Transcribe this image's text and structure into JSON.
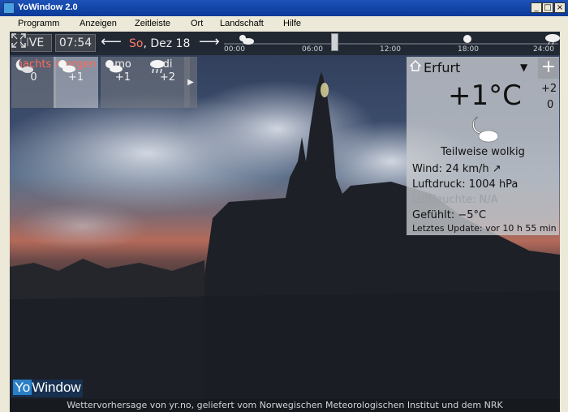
{
  "window": {
    "title": "YoWindow 2.0",
    "min_label": "_",
    "max_label": "□",
    "close_label": "×"
  },
  "menu": [
    "Programm",
    "Anzeigen",
    "Zeitleiste",
    "Ort",
    "Landschaft",
    "Hilfe"
  ],
  "topbar": {
    "live": "LIVE",
    "time": "07:54",
    "back_arrow": "⟵",
    "fwd_arrow": "⟶",
    "date_dow": "So",
    "date_rest": ", Dez 18",
    "ticks": [
      "00:00",
      "06:00",
      "12:00",
      "18:00",
      "24:00"
    ]
  },
  "forecast": [
    {
      "name": "nachts",
      "temp": "0",
      "icon": "moon-cloud-icon",
      "highlight": true
    },
    {
      "name": "morgen",
      "temp": "+1",
      "icon": "sun-cloud-icon",
      "highlight": true,
      "selected": true
    },
    {
      "name": "mo",
      "temp": "+1",
      "icon": "sun-cloud-icon"
    },
    {
      "name": "di",
      "temp": "+2",
      "icon": "rain-cloud-icon"
    }
  ],
  "forecast_next": "▶",
  "panel": {
    "city": "Erfurt",
    "dropdown": "▼",
    "add": "+",
    "temperature": "+1°C",
    "side_top": "+2",
    "side_bottom": "0",
    "condition": "Teilweise wolkig",
    "wind": "Wind:  24 km/h  ↗",
    "pressure": "Luftdruck:  1004 hPa",
    "humidity": "Luftfeuchte:  N/A",
    "feels": "Gefühlt:  −5°C",
    "updated": "Letztes Update:  vor 10 h 55 min"
  },
  "brand": {
    "yo": "Yo",
    "window": "Window"
  },
  "credit": "Wettervorhersage von yr.no, geliefert vom Norwegischen Meteorologischen Institut und dem NRK"
}
